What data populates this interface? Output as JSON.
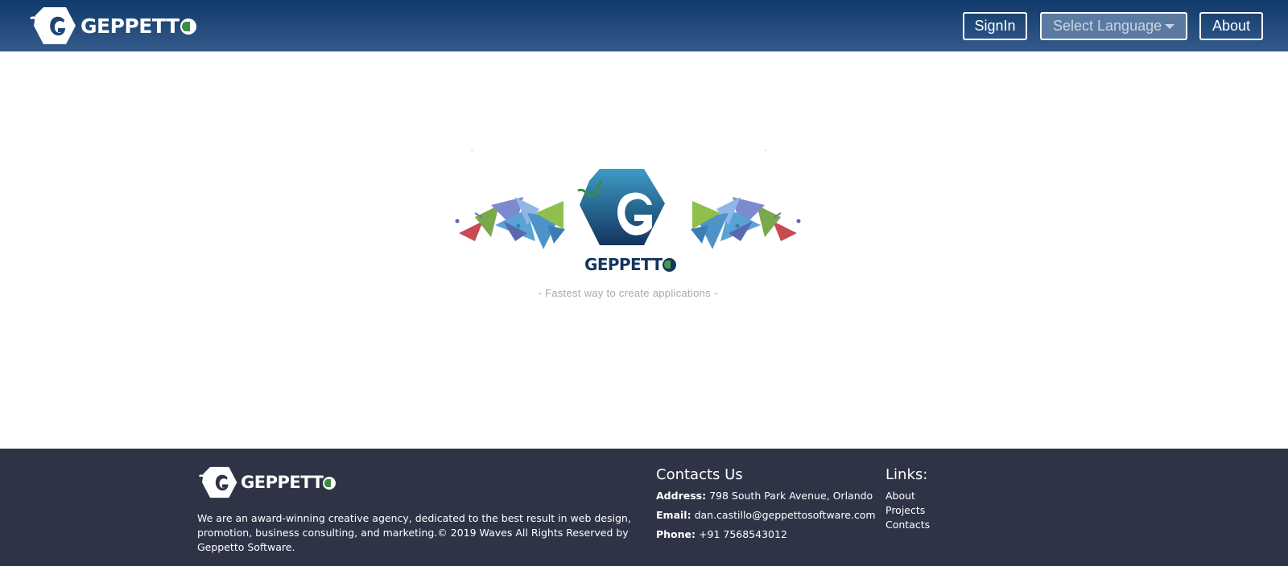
{
  "header": {
    "brand": "GEPPETT",
    "signin_label": "SignIn",
    "language_label": "Select Language",
    "about_label": "About"
  },
  "hero": {
    "brand": "GEPPETT",
    "tagline": "- Fastest way to create applications -"
  },
  "footer": {
    "brand": "GEPPETT",
    "about_text": "We are an award-winning creative agency, dedicated to the best result in web design, promotion, business consulting, and marketing.© 2019 Waves All Rights Reserved by Geppetto Software.",
    "contacts_heading": "Contacts Us",
    "address_label": "Address:",
    "address_value": "798 South Park Avenue, Orlando",
    "email_label": "Email:",
    "email_value": "dan.castillo@geppettosoftware.com",
    "phone_label": "Phone:",
    "phone_value": "+91 7568543012",
    "links_heading": "Links:",
    "links": [
      "About",
      "Projects",
      "Contacts"
    ]
  },
  "colors": {
    "header_top": "#0f3a6b",
    "header_bottom": "#345a8a",
    "footer_bg": "#2f3346",
    "logo_navy": "#14365e",
    "accent_green": "#3f8a3f"
  },
  "icons": {
    "header_logo": "puzzle-g-logo-icon",
    "hero_logo": "puzzle-g-logo-icon",
    "footer_logo": "puzzle-g-logo-icon",
    "language_caret": "caret-down-icon"
  }
}
